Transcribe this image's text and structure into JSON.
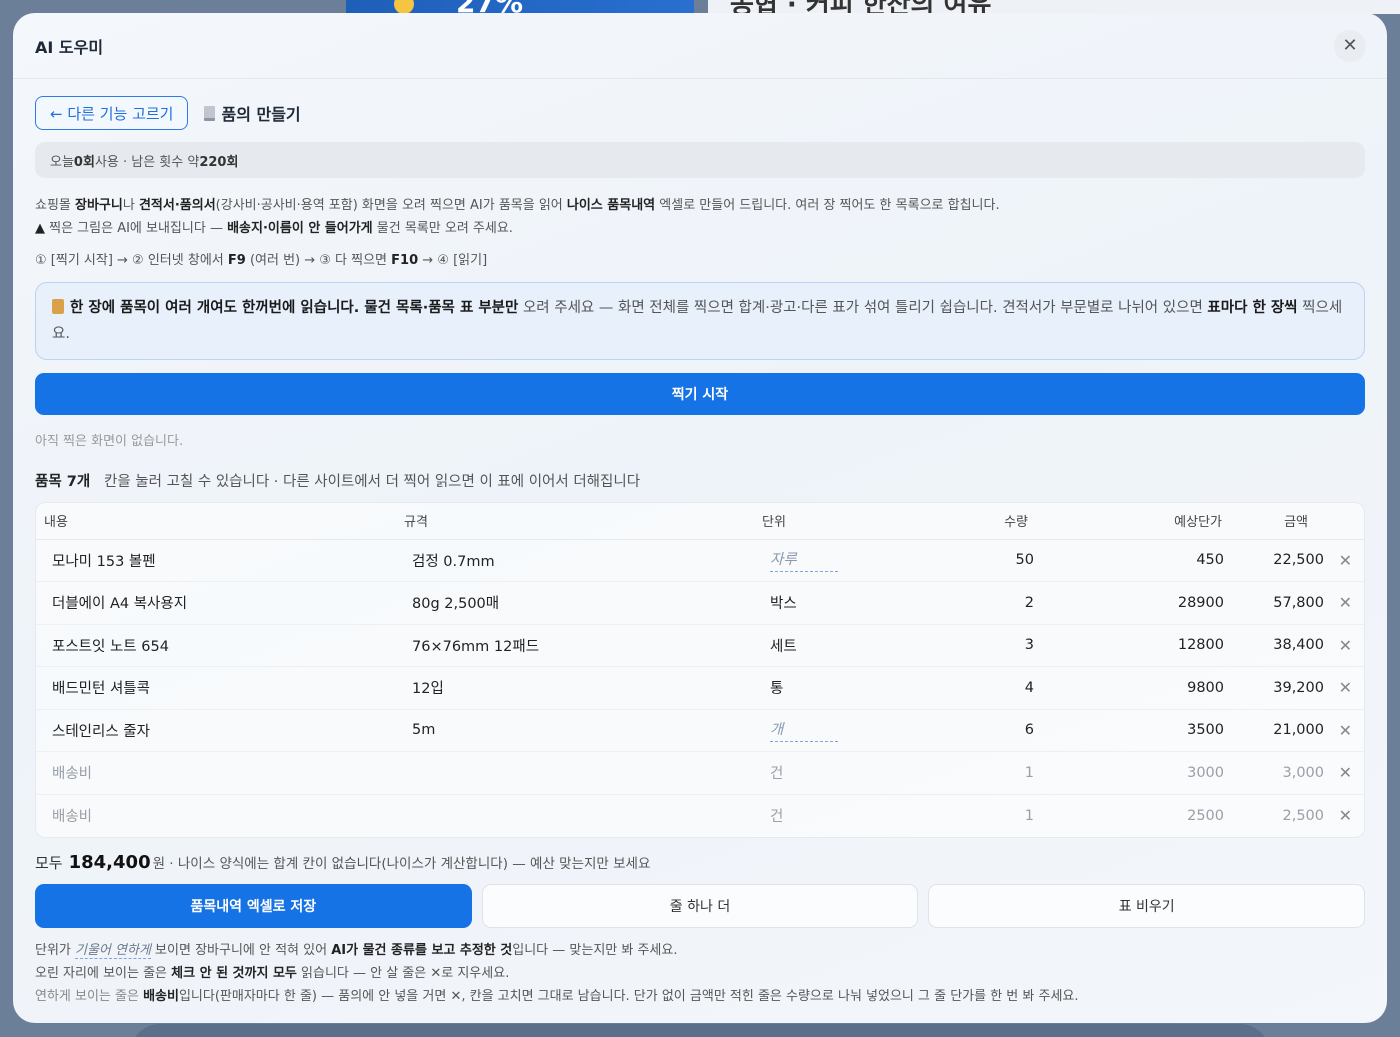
{
  "background": {
    "banner_number": "27%",
    "right_title": "농협 · 커피 한잔의 여유"
  },
  "modal": {
    "title": "AI 도우미",
    "close_icon": "close-icon"
  },
  "nav": {
    "back_label": "← 다른 기능 고르기",
    "feature_label": "품의 만들기"
  },
  "usage": {
    "prefix": "오늘 ",
    "used": "0회",
    "middle": " 사용 · 남은 횟수 약 ",
    "remaining": "220회"
  },
  "description": {
    "line1_a": "쇼핑몰 ",
    "line1_b": "장바구니",
    "line1_c": "나 ",
    "line1_d": "견적서·품의서",
    "line1_e": "(강사비·공사비·용역 포함) 화면을 오려 찍으면 AI가 품목을 읽어 ",
    "line1_f": "나이스 품목내역",
    "line1_g": " 엑셀로 만들어 드립니다. 여러 장 찍어도 한 목록으로 합칩니다.",
    "line2_icon": "▲",
    "line2_a": " 찍은 그림은 AI에 보내집니다 — ",
    "line2_b": "배송지·이름이 안 들어가게",
    "line2_c": " 물건 목록만 오려 주세요."
  },
  "steps": {
    "s1": "① [찍기 시작] → ② 인터넷 창에서 ",
    "f9": "F9",
    "s2": " (여러 번) → ③ 다 찍으면 ",
    "f10": "F10",
    "s3": " → ④ [읽기]"
  },
  "notice": {
    "bold1": "한 장에 품목이 여러 개여도 한꺼번에 읽습니다. 물건 목록·품목 표 부분만",
    "text1": " 오려 주세요 — 화면 전체를 찍으면 합계·광고·다른 표가 섞여 틀리기 쉽습니다. 견적서가 부문별로 나뉘어 있으면 ",
    "bold2": "표마다 한 장씩",
    "text2": " 찍으세요."
  },
  "capture_button": "찍기 시작",
  "empty_note": "아직 찍은 화면이 없습니다.",
  "items_header": {
    "count": "품목 7개",
    "hint": "   칸을 눌러 고칠 수 있습니다 · 다른 사이트에서 더 찍어 읽으면 이 표에 이어서 더해집니다"
  },
  "table": {
    "columns": [
      "내용",
      "규격",
      "단위",
      "수량",
      "예상단가",
      "금액"
    ],
    "rows": [
      {
        "name": "모나미 153 볼펜",
        "spec": "검정 0.7mm",
        "unit": "자루",
        "qty": "50",
        "price": "450",
        "amount": "22,500",
        "guessed": true,
        "faded": false
      },
      {
        "name": "더블에이 A4 복사용지",
        "spec": "80g 2,500매",
        "unit": "박스",
        "qty": "2",
        "price": "28900",
        "amount": "57,800",
        "guessed": false,
        "faded": false
      },
      {
        "name": "포스트잇 노트 654",
        "spec": "76×76mm 12패드",
        "unit": "세트",
        "qty": "3",
        "price": "12800",
        "amount": "38,400",
        "guessed": false,
        "faded": false
      },
      {
        "name": "배드민턴 셔틀콕",
        "spec": "12입",
        "unit": "통",
        "qty": "4",
        "price": "9800",
        "amount": "39,200",
        "guessed": false,
        "faded": false
      },
      {
        "name": "스테인리스 줄자",
        "spec": "5m",
        "unit": "개",
        "qty": "6",
        "price": "3500",
        "amount": "21,000",
        "guessed": true,
        "faded": false
      },
      {
        "name": "배송비",
        "spec": "",
        "unit": "건",
        "qty": "1",
        "price": "3000",
        "amount": "3,000",
        "guessed": false,
        "faded": true
      },
      {
        "name": "배송비",
        "spec": "",
        "unit": "건",
        "qty": "1",
        "price": "2500",
        "amount": "2,500",
        "guessed": false,
        "faded": true
      }
    ],
    "delete_glyph": "✕"
  },
  "total": {
    "label": "모두",
    "amount": "184,400",
    "suffix": "원 · 나이스 양식에는 합계 칸이 없습니다(나이스가 계산합니다) — 예산 맞는지만 보세요"
  },
  "actions": {
    "save": "품목내역 엑셀로 저장",
    "add_row": "줄 하나 더",
    "clear": "표 비우기"
  },
  "footnotes": {
    "l1_a": "단위가 ",
    "l1_b": "기울어 연하게",
    "l1_c": " 보이면 장바구니에 안 적혀 있어 ",
    "l1_d": "AI가 물건 종류를 보고 추정한 것",
    "l1_e": "입니다 — 맞는지만 봐 주세요.",
    "l2_a": "오린 자리에 보이는 줄은 ",
    "l2_b": "체크 안 된 것까지 모두",
    "l2_c": " 읽습니다 — 안 살 줄은 ✕로 지우세요.",
    "l3_a": "연하게 보이는 줄은 ",
    "l3_b": "배송비",
    "l3_c": "입니다(판매자마다 한 줄) — 품의에 안 넣을 거면 ✕, 칸을 고치면 그대로 남습니다. 단가 없이 금액만 적힌 줄은 수량으로 나눠 넣었으니 그 줄 단가를 한 번 봐 주세요."
  },
  "colors": {
    "accent": "#1673e6",
    "notice_bg": "#e7f0fb",
    "notice_border": "#b9d3f3"
  }
}
